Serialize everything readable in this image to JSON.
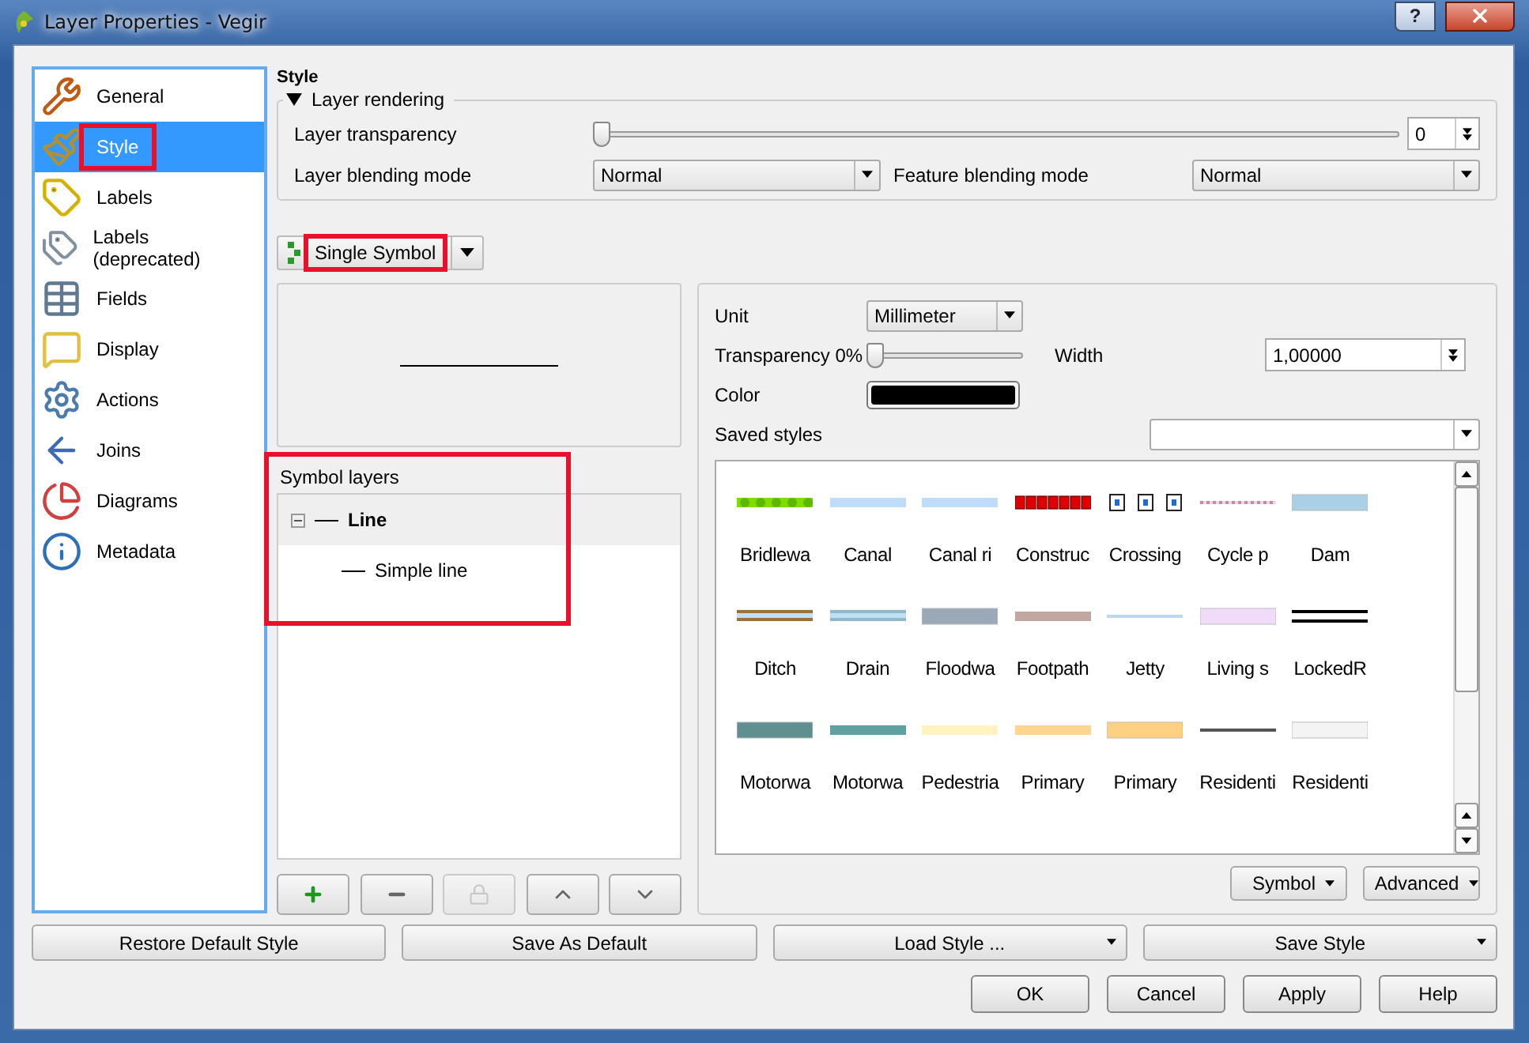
{
  "window": {
    "title": "Layer Properties - Vegir",
    "help": "?"
  },
  "sidebar": {
    "items": [
      {
        "label": "General",
        "selected": false,
        "highlighted": false
      },
      {
        "label": "Style",
        "selected": true,
        "highlighted": true
      },
      {
        "label": "Labels",
        "selected": false,
        "highlighted": false
      },
      {
        "label": "Labels (deprecated)",
        "selected": false,
        "highlighted": false
      },
      {
        "label": "Fields",
        "selected": false,
        "highlighted": false
      },
      {
        "label": "Display",
        "selected": false,
        "highlighted": false
      },
      {
        "label": "Actions",
        "selected": false,
        "highlighted": false
      },
      {
        "label": "Joins",
        "selected": false,
        "highlighted": false
      },
      {
        "label": "Diagrams",
        "selected": false,
        "highlighted": false
      },
      {
        "label": "Metadata",
        "selected": false,
        "highlighted": false
      }
    ]
  },
  "page_title": "Style",
  "layer_rendering": {
    "title": "Layer rendering",
    "expanded": true,
    "transparency": {
      "label": "Layer transparency",
      "level": 0,
      "value": "0"
    },
    "layer_blending": {
      "label": "Layer blending mode",
      "value": "Normal"
    },
    "feature_blending": {
      "label": "Feature blending mode",
      "value": "Normal"
    }
  },
  "renderer": {
    "value": "Single Symbol",
    "highlighted": true
  },
  "symbol_layers": {
    "label": "Symbol layers",
    "highlighted": true,
    "tree": [
      {
        "label": "Line",
        "selected": true,
        "expanded": true,
        "children": [
          {
            "label": "Simple line",
            "selected": false
          }
        ]
      }
    ],
    "buttons": [
      {
        "kind": "add",
        "disabled": false
      },
      {
        "kind": "remove",
        "disabled": false
      },
      {
        "kind": "lock",
        "disabled": true
      },
      {
        "kind": "up",
        "disabled": false
      },
      {
        "kind": "down",
        "disabled": false
      }
    ]
  },
  "symbol_properties": {
    "unit": {
      "label": "Unit",
      "value": "Millimeter"
    },
    "transparency": {
      "label": "Transparency 0%",
      "level": 0
    },
    "width": {
      "label": "Width",
      "value": "1,00000"
    },
    "color": {
      "label": "Color",
      "color": "#000000"
    },
    "saved_styles": {
      "label": "Saved styles"
    },
    "library": [
      {
        "label": "Bridlewa",
        "kind": "dashed",
        "color": "#5cb800"
      },
      {
        "label": "Canal",
        "kind": "solid",
        "color": "#bfdcf9"
      },
      {
        "label": "Canal ri",
        "kind": "solid",
        "color": "#bfdcf9"
      },
      {
        "label": "Construc",
        "kind": "squares",
        "color": "#e00000"
      },
      {
        "label": "Crossing",
        "kind": "markers",
        "color": "#1f6fd0"
      },
      {
        "label": "Cycle p",
        "kind": "dotted",
        "color": "#c08aa8"
      },
      {
        "label": "Dam",
        "kind": "thick",
        "color": "#a9d0e4"
      },
      {
        "label": "Ditch",
        "kind": "cased",
        "color": "#a0703c"
      },
      {
        "label": "Drain",
        "kind": "cased",
        "color": "#8fb8c8"
      },
      {
        "label": "Floodwa",
        "kind": "thick",
        "color": "#9aa8b8"
      },
      {
        "label": "Footpath",
        "kind": "solid",
        "color": "#c0a8a0"
      },
      {
        "label": "Jetty",
        "kind": "thin",
        "color": "#bcd8f0"
      },
      {
        "label": "Living s",
        "kind": "thick",
        "color": "#f0dcf8"
      },
      {
        "label": "LockedR",
        "kind": "double",
        "color": "#000000"
      },
      {
        "label": "Motorwa",
        "kind": "thick",
        "color": "#5f8f8f"
      },
      {
        "label": "Motorwa",
        "kind": "solid",
        "color": "#5fa0a0"
      },
      {
        "label": "Pedestria",
        "kind": "solid",
        "color": "#fff3c0"
      },
      {
        "label": "Primary",
        "kind": "solid",
        "color": "#fdd590"
      },
      {
        "label": "Primary",
        "kind": "thick",
        "color": "#fed082"
      },
      {
        "label": "Residenti",
        "kind": "thin",
        "color": "#555555"
      },
      {
        "label": "Residenti",
        "kind": "thick",
        "color": "#f4f4f4"
      }
    ],
    "buttons": [
      "Symbol",
      "Advanced"
    ]
  },
  "style_buttons": [
    {
      "label": "Restore Default Style",
      "menu": false
    },
    {
      "label": "Save As Default",
      "menu": false
    },
    {
      "label": "Load Style ...",
      "menu": true
    },
    {
      "label": "Save Style",
      "menu": true
    }
  ],
  "dialog_buttons": [
    "OK",
    "Cancel",
    "Apply",
    "Help"
  ]
}
